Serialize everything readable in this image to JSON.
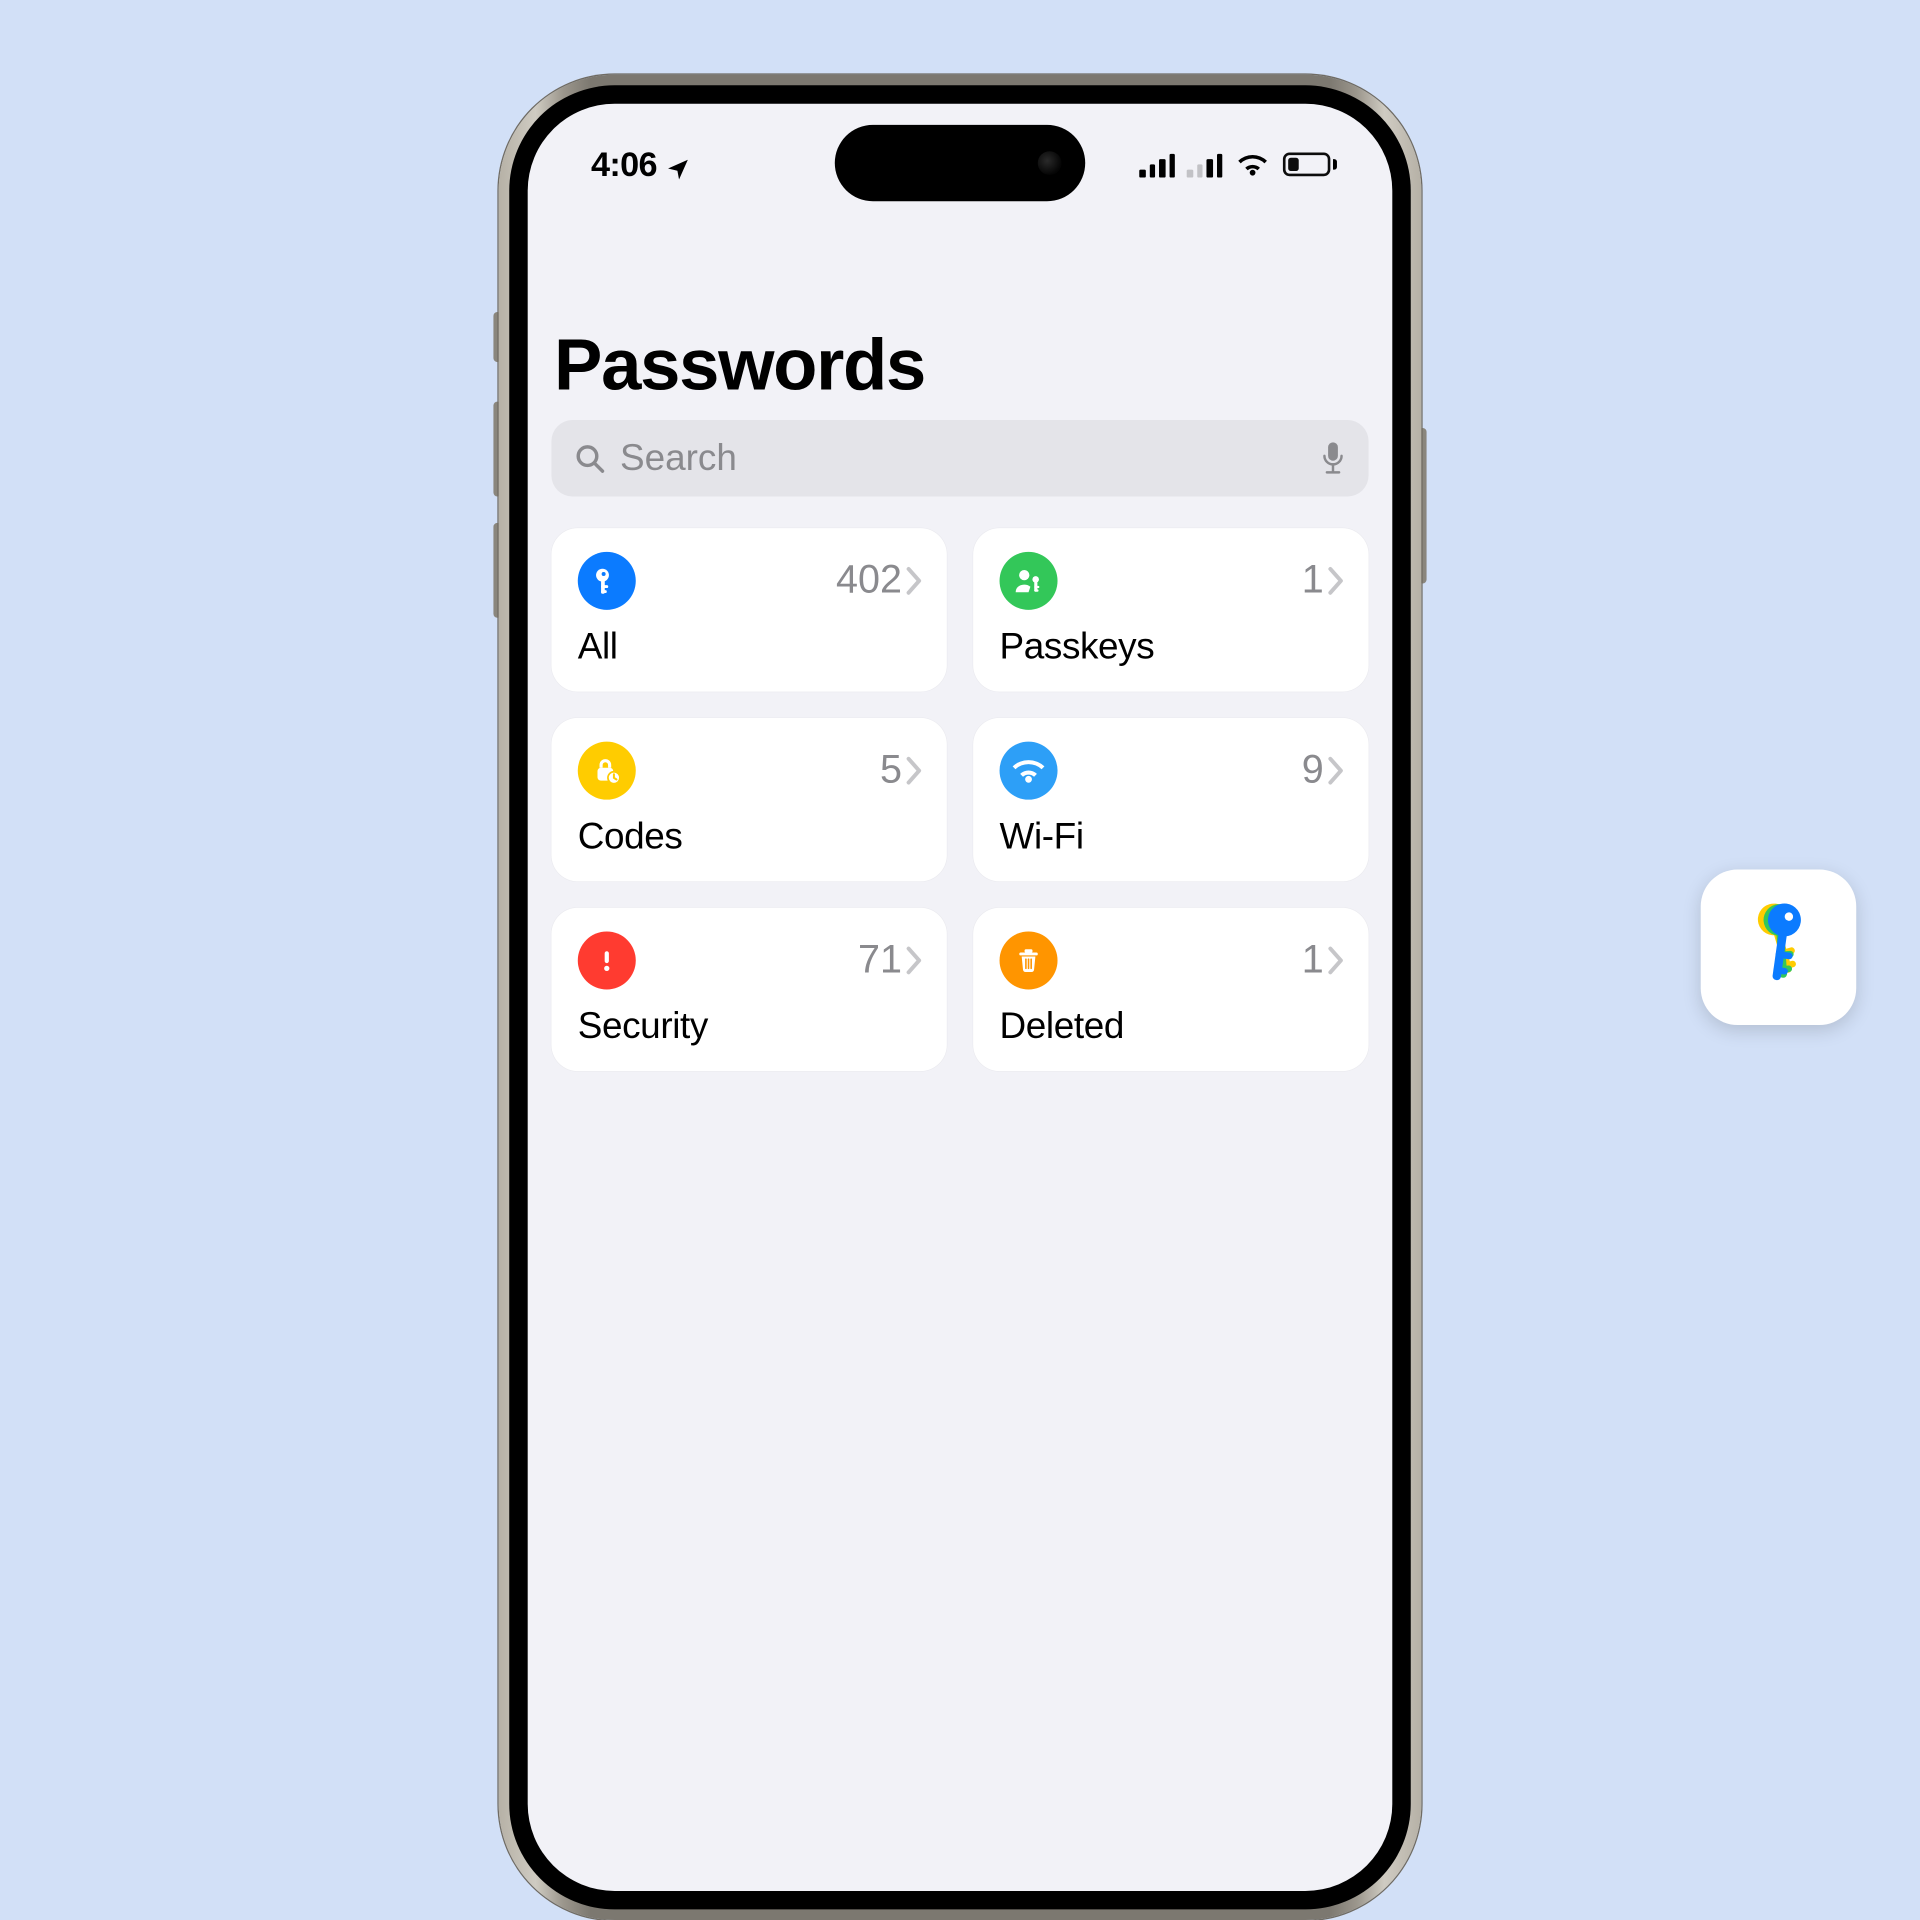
{
  "status": {
    "time": "4:06",
    "location_active": true,
    "cellular": {
      "bars": 4,
      "active": 4
    },
    "wifi": "full",
    "battery_percent": 26
  },
  "header": {
    "title": "Passwords"
  },
  "search": {
    "placeholder": "Search",
    "value": ""
  },
  "categories": [
    {
      "id": "all",
      "icon": "key-icon",
      "color": "#0b7bff",
      "label": "All",
      "count": "402"
    },
    {
      "id": "passkeys",
      "icon": "passkey-icon",
      "color": "#33c759",
      "label": "Passkeys",
      "count": "1"
    },
    {
      "id": "codes",
      "icon": "lock-clock-icon",
      "color": "#ffcc00",
      "label": "Codes",
      "count": "5"
    },
    {
      "id": "wifi",
      "icon": "wifi-icon",
      "color": "#2d9ff7",
      "label": "Wi-Fi",
      "count": "9"
    },
    {
      "id": "security",
      "icon": "alert-icon",
      "color": "#ff3b30",
      "label": "Security",
      "count": "71"
    },
    {
      "id": "deleted",
      "icon": "trash-icon",
      "color": "#ff9500",
      "label": "Deleted",
      "count": "1"
    }
  ],
  "app_badge": {
    "name": "Passwords",
    "colors": [
      "#ffcc00",
      "#33c759",
      "#0b7bff"
    ]
  }
}
